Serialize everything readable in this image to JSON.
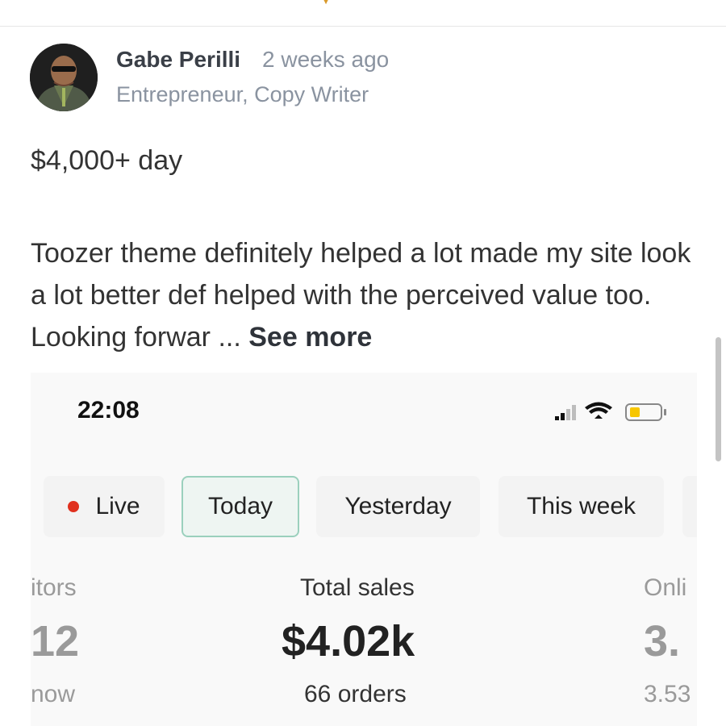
{
  "post": {
    "author_name": "Gabe Perilli",
    "time_ago": "2 weeks ago",
    "author_role": "Entrepreneur, Copy Writer",
    "headline": "$4,000+ day",
    "body": "Toozer theme definitely helped a lot made my site look a lot better def helped with the perceived value too. Looking forwar",
    "ellipsis": " ... ",
    "see_more_label": "See more"
  },
  "screenshot": {
    "status_time": "22:08",
    "battery_color": "#f7c600",
    "filters": [
      {
        "label": "Live",
        "dot_color": "#e0301e"
      },
      {
        "label": "Today",
        "selected": true
      },
      {
        "label": "Yesterday"
      },
      {
        "label": "This week"
      }
    ],
    "metrics": {
      "left": {
        "label": "itors",
        "value": "12",
        "sub": "now"
      },
      "center": {
        "label": "Total sales",
        "value": "$4.02k",
        "sub": "66 orders"
      },
      "right": {
        "label": "Onli",
        "value": "3.",
        "sub": "3.53"
      }
    }
  },
  "icons": [
    "avatar",
    "cellular-signal-icon",
    "wifi-icon",
    "battery-icon"
  ]
}
